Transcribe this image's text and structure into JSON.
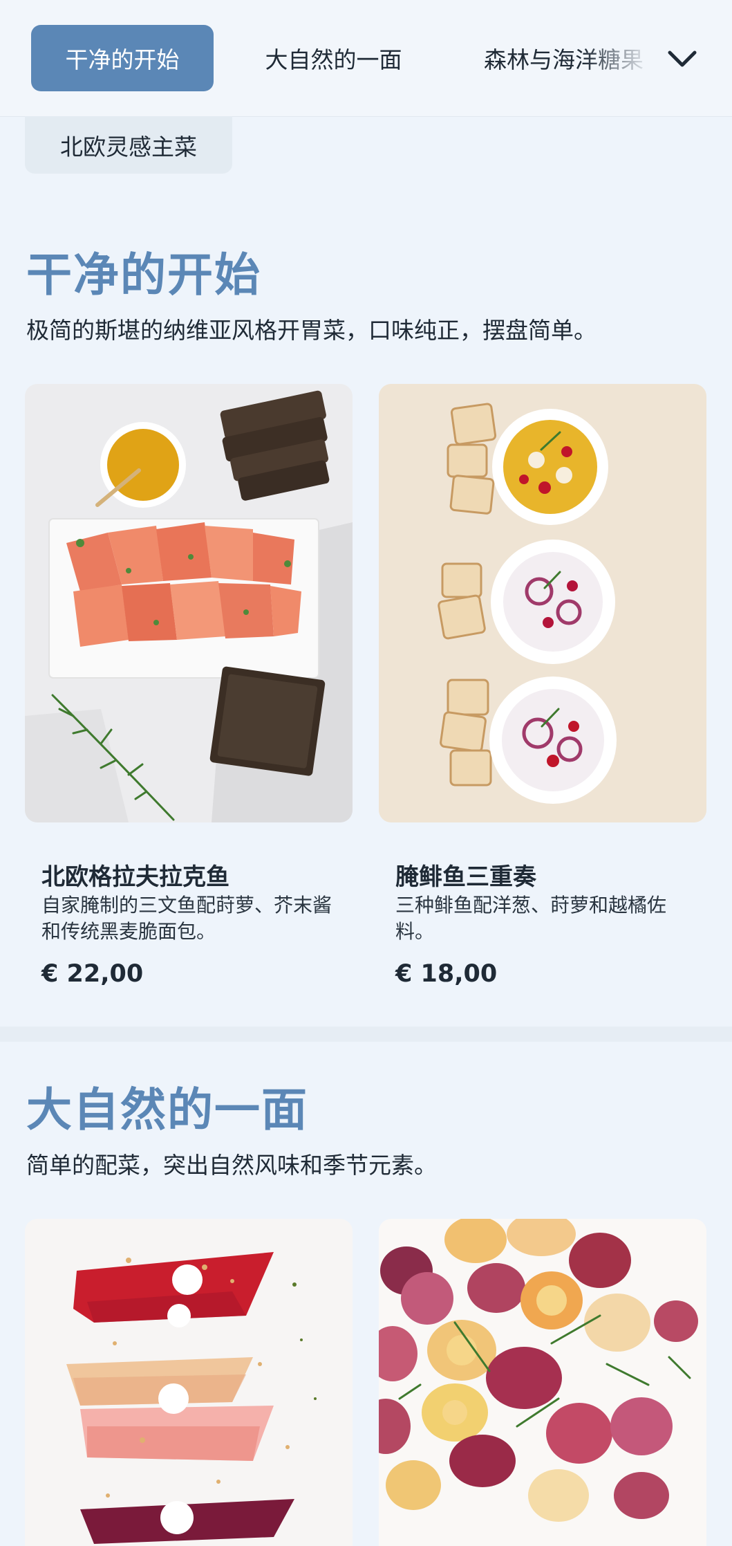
{
  "nav": {
    "tabs": [
      {
        "label": "干净的开始",
        "active": true
      },
      {
        "label": "大自然的一面",
        "active": false
      },
      {
        "label": "森林与海洋糖果",
        "active": false
      }
    ],
    "second_row_tab": "北欧灵感主菜",
    "expand_icon": "chevron-down-icon"
  },
  "sections": [
    {
      "title": "干净的开始",
      "description": "极简的斯堪的纳维亚风格开胃菜，口味纯正，摆盘简单。",
      "dishes": [
        {
          "name": "北欧格拉夫拉克鱼",
          "description": "自家腌制的三文鱼配莳萝、芥末酱和传统黑麦脆面包。",
          "price": "€ 22,00"
        },
        {
          "name": "腌鲱鱼三重奏",
          "description": "三种鲱鱼配洋葱、莳萝和越橘佐料。",
          "price": "€ 18,00"
        }
      ]
    },
    {
      "title": "大自然的一面",
      "description": "简单的配菜，突出自然风味和季节元素。"
    }
  ],
  "colors": {
    "accent": "#5b87b6",
    "background": "#eef4fb",
    "text": "#1f2a36"
  }
}
